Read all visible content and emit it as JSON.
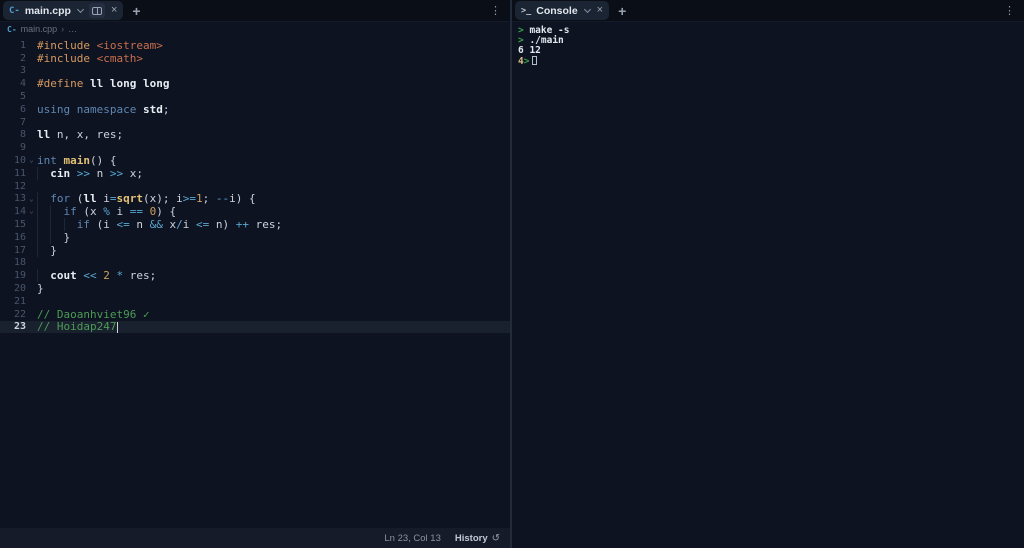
{
  "colors": {
    "background": "#0d1320",
    "tab_active_bg": "#1b2433",
    "current_line_bg": "#19212f",
    "keyword": "#5f86b3",
    "directive": "#d7995f",
    "header_string": "#c96f4d",
    "function": "#e2c076",
    "operator": "#5aa7d3",
    "number": "#cfa05e",
    "comment": "#4c9b55",
    "prompt_green": "#3a9e4d",
    "cpp_icon_blue": "#4f9fd4"
  },
  "editor_panel": {
    "tab_label": "main.cpp",
    "breadcrumb": {
      "file": "main.cpp",
      "symbol": "…"
    },
    "cursor_line": 23,
    "lines": [
      {
        "n": "1",
        "t": [
          [
            "dir",
            "#include"
          ],
          [
            "pln",
            " "
          ],
          [
            "str",
            "<iostream>"
          ]
        ]
      },
      {
        "n": "2",
        "t": [
          [
            "dir",
            "#include"
          ],
          [
            "pln",
            " "
          ],
          [
            "str",
            "<cmath>"
          ]
        ]
      },
      {
        "n": "3",
        "t": []
      },
      {
        "n": "4",
        "t": [
          [
            "dir",
            "#define"
          ],
          [
            "pln",
            " "
          ],
          [
            "bold",
            "ll"
          ],
          [
            "pln",
            " "
          ],
          [
            "bold",
            "long long"
          ]
        ]
      },
      {
        "n": "5",
        "t": []
      },
      {
        "n": "6",
        "t": [
          [
            "kw",
            "using"
          ],
          [
            "pln",
            " "
          ],
          [
            "kw",
            "namespace"
          ],
          [
            "pln",
            " "
          ],
          [
            "bold",
            "std"
          ],
          [
            "pln",
            ";"
          ]
        ]
      },
      {
        "n": "7",
        "t": []
      },
      {
        "n": "8",
        "t": [
          [
            "bold",
            "ll"
          ],
          [
            "pln",
            " n, x, res;"
          ]
        ]
      },
      {
        "n": "9",
        "t": []
      },
      {
        "n": "10",
        "fold": true,
        "t": [
          [
            "kw",
            "int"
          ],
          [
            "pln",
            " "
          ],
          [
            "fn",
            "main"
          ],
          [
            "pln",
            "() {"
          ]
        ]
      },
      {
        "n": "11",
        "t": [
          [
            "ind",
            "  "
          ],
          [
            "bold",
            "cin"
          ],
          [
            "pln",
            " "
          ],
          [
            "op",
            ">>"
          ],
          [
            "pln",
            " n "
          ],
          [
            "op",
            ">>"
          ],
          [
            "pln",
            " x;"
          ]
        ]
      },
      {
        "n": "12",
        "t": []
      },
      {
        "n": "13",
        "fold": true,
        "t": [
          [
            "ind",
            "  "
          ],
          [
            "kw",
            "for"
          ],
          [
            "pln",
            " ("
          ],
          [
            "bold",
            "ll"
          ],
          [
            "pln",
            " i"
          ],
          [
            "op",
            "="
          ],
          [
            "fn",
            "sqrt"
          ],
          [
            "pln",
            "(x); i"
          ],
          [
            "op",
            ">="
          ],
          [
            "num",
            "1"
          ],
          [
            "pln",
            "; "
          ],
          [
            "op",
            "--"
          ],
          [
            "pln",
            "i) {"
          ]
        ]
      },
      {
        "n": "14",
        "fold": true,
        "t": [
          [
            "ind",
            "  "
          ],
          [
            "ind",
            "  "
          ],
          [
            "kw",
            "if"
          ],
          [
            "pln",
            " (x "
          ],
          [
            "op",
            "%"
          ],
          [
            "pln",
            " i "
          ],
          [
            "op",
            "=="
          ],
          [
            "pln",
            " "
          ],
          [
            "num",
            "0"
          ],
          [
            "pln",
            ") {"
          ]
        ]
      },
      {
        "n": "15",
        "t": [
          [
            "ind",
            "  "
          ],
          [
            "ind",
            "  "
          ],
          [
            "ind",
            "  "
          ],
          [
            "kw",
            "if"
          ],
          [
            "pln",
            " (i "
          ],
          [
            "op",
            "<="
          ],
          [
            "pln",
            " n "
          ],
          [
            "op",
            "&&"
          ],
          [
            "pln",
            " x"
          ],
          [
            "op",
            "/"
          ],
          [
            "pln",
            "i "
          ],
          [
            "op",
            "<="
          ],
          [
            "pln",
            " n) "
          ],
          [
            "op",
            "++"
          ],
          [
            "pln",
            " res;"
          ]
        ]
      },
      {
        "n": "16",
        "t": [
          [
            "ind",
            "  "
          ],
          [
            "ind",
            "  "
          ],
          [
            "pln",
            "}"
          ]
        ]
      },
      {
        "n": "17",
        "t": [
          [
            "ind",
            "  "
          ],
          [
            "pln",
            "}"
          ]
        ]
      },
      {
        "n": "18",
        "t": []
      },
      {
        "n": "19",
        "t": [
          [
            "ind",
            "  "
          ],
          [
            "bold",
            "cout"
          ],
          [
            "pln",
            " "
          ],
          [
            "op",
            "<<"
          ],
          [
            "pln",
            " "
          ],
          [
            "num",
            "2"
          ],
          [
            "pln",
            " "
          ],
          [
            "op",
            "*"
          ],
          [
            "pln",
            " res;"
          ]
        ]
      },
      {
        "n": "20",
        "t": [
          [
            "pln",
            "}"
          ]
        ]
      },
      {
        "n": "21",
        "t": []
      },
      {
        "n": "22",
        "t": [
          [
            "cmt",
            "// Daoanhviet96 ✓"
          ]
        ]
      },
      {
        "n": "23",
        "current": true,
        "cursor_end": true,
        "t": [
          [
            "cmt",
            "// Hoidap247"
          ]
        ]
      }
    ]
  },
  "console_panel": {
    "tab_label": "Console",
    "terminal_icon": ">_",
    "lines": [
      {
        "prompt": ">",
        "cmd": "make -s"
      },
      {
        "prompt": ">",
        "cmd": "./main"
      },
      {
        "input": "6 12"
      },
      {
        "out": "4",
        "prompt": ">",
        "cursor": true
      }
    ]
  },
  "statusbar": {
    "position": "Ln 23, Col 13",
    "history_label": "History",
    "history_icon": "↺"
  },
  "misc": {
    "close_glyph": "×",
    "plus_glyph": "+",
    "kebab_glyph": "⋮",
    "crumb_sep": "›",
    "cpp_icon_text": "C-"
  }
}
